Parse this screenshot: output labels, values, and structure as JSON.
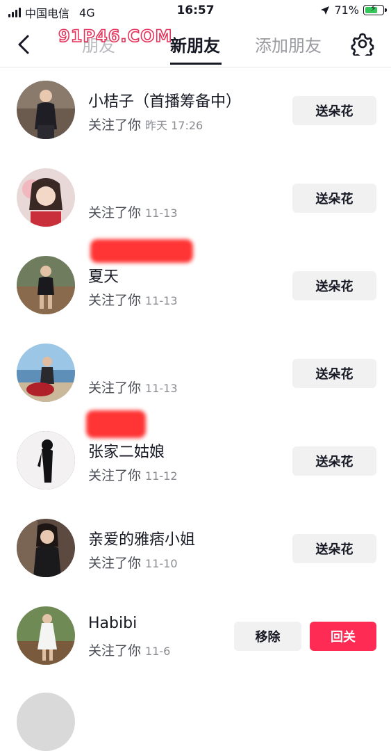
{
  "status_bar": {
    "carrier": "中国电信",
    "network": "4G",
    "time": "16:57",
    "battery": "71%",
    "battery_level": 0.71
  },
  "header": {
    "back_icon": "chevron-left-icon",
    "tabs": [
      {
        "label": "朋友"
      },
      {
        "label": "新朋友"
      },
      {
        "label": "添加朋友"
      }
    ],
    "active_tab": "新朋友",
    "settings_icon": "gear-icon",
    "watermark": "91P46.COM"
  },
  "followers": [
    {
      "name": "小桔子（首播筹备中）",
      "action": "关注了你",
      "date": "昨天 17:26",
      "button": "送朵花"
    },
    {
      "name": "",
      "action": "关注了你",
      "date": "11-13",
      "button": "送朵花",
      "name_redacted": true
    },
    {
      "name": "夏天",
      "action": "关注了你",
      "date": "11-13",
      "button": "送朵花"
    },
    {
      "name": "",
      "action": "关注了你",
      "date": "11-13",
      "button": "送朵花",
      "name_redacted": true
    },
    {
      "name": "张家二姑娘",
      "action": "关注了你",
      "date": "11-12",
      "button": "送朵花"
    },
    {
      "name": "亲爱的雅痞小姐",
      "action": "关注了你",
      "date": "11-10",
      "button": "送朵花"
    },
    {
      "name": "Habibi",
      "action": "关注了你",
      "date": "11-6",
      "remove_button": "移除",
      "follow_back_button": "回关"
    }
  ],
  "colors": {
    "primary_text": "#161823",
    "secondary_text": "#4b4d55",
    "accent": "#fe2c55",
    "button_gray": "#f1f1f2"
  }
}
